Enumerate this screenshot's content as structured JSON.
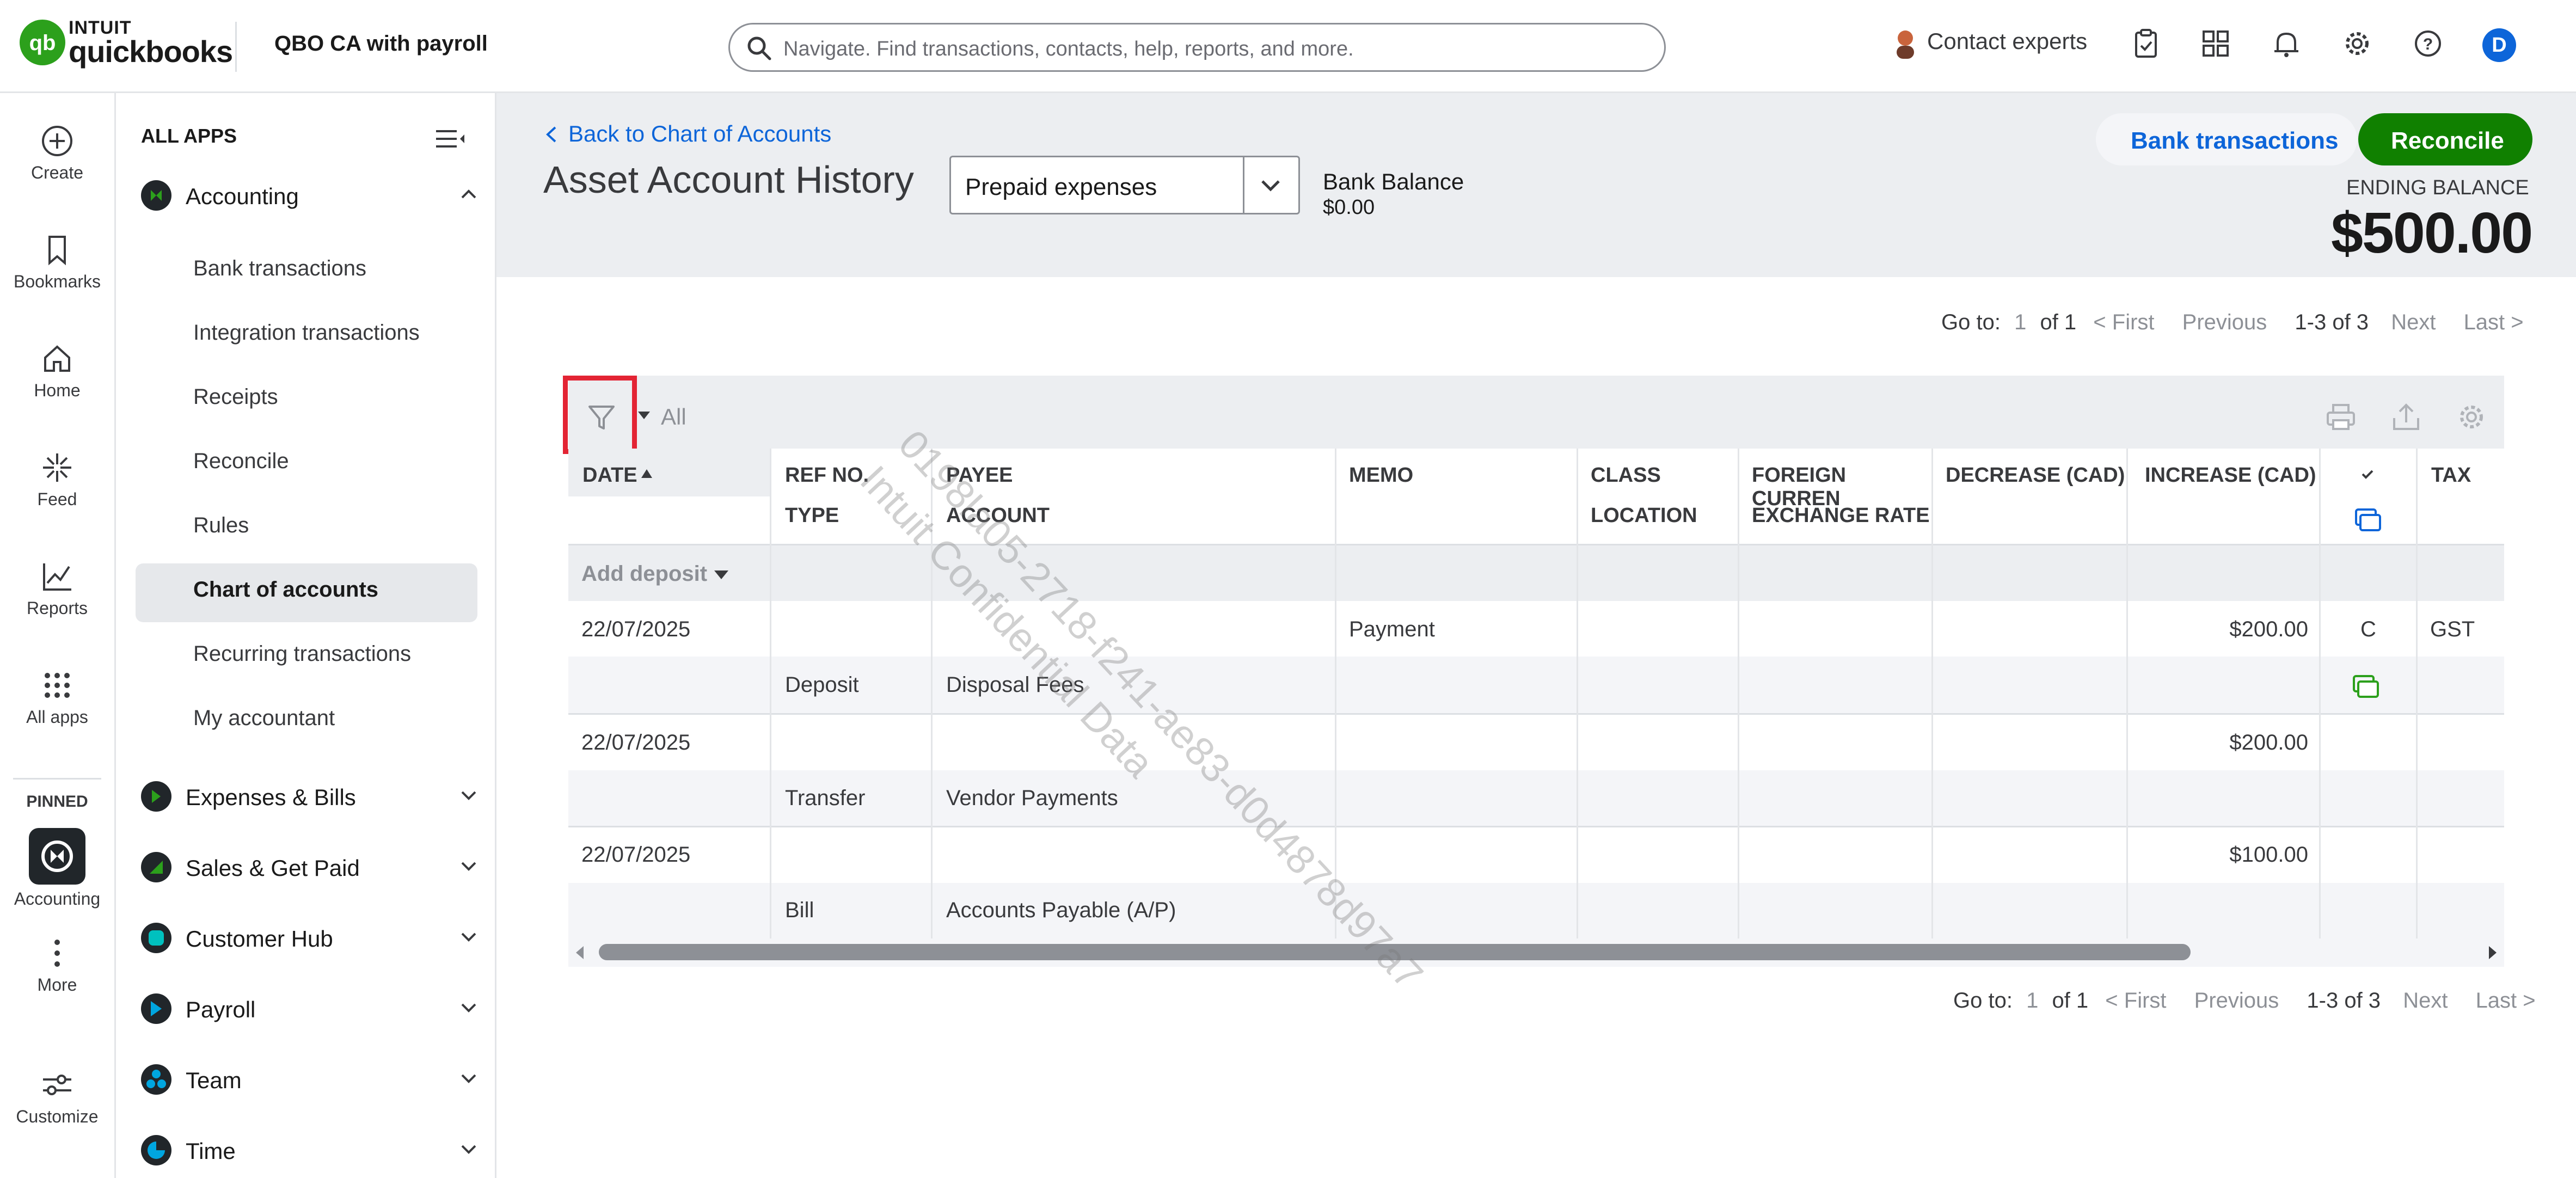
{
  "topbar": {
    "logo_top": "INTUIT",
    "logo_main": "quickbooks",
    "company": "QBO CA with payroll",
    "search_placeholder": "Navigate. Find transactions, contacts, help, reports, and more.",
    "contact_experts": "Contact experts",
    "avatar_letter": "D"
  },
  "rail": {
    "create": "Create",
    "bookmarks": "Bookmarks",
    "home": "Home",
    "feed": "Feed",
    "reports": "Reports",
    "all_apps": "All apps",
    "pinned": "PINNED",
    "accounting": "Accounting",
    "more": "More",
    "customize": "Customize"
  },
  "nav": {
    "all_apps": "ALL APPS",
    "accounting": "Accounting",
    "sub": [
      "Bank transactions",
      "Integration transactions",
      "Receipts",
      "Reconcile",
      "Rules",
      "Chart of accounts",
      "Recurring transactions",
      "My accountant"
    ],
    "sections": [
      "Expenses & Bills",
      "Sales & Get Paid",
      "Customer Hub",
      "Payroll",
      "Team",
      "Time"
    ]
  },
  "header": {
    "back": "Back to Chart of Accounts",
    "title": "Asset Account History",
    "account": "Prepaid expenses",
    "bank_balance_label": "Bank Balance",
    "bank_balance": "$0.00",
    "bank_transactions_btn": "Bank transactions",
    "reconcile_btn": "Reconcile",
    "ending_balance_label": "ENDING BALANCE",
    "ending_balance": "$500.00"
  },
  "pager": {
    "goto": "Go to:",
    "page": "1",
    "of": "of 1",
    "first": "< First",
    "previous": "Previous",
    "range": "1-3 of 3",
    "next": "Next",
    "last": "Last >"
  },
  "toolbar": {
    "filter_value": "All"
  },
  "columns": {
    "date": "DATE",
    "ref": "REF NO.",
    "type": "TYPE",
    "payee": "PAYEE",
    "account": "ACCOUNT",
    "memo": "MEMO",
    "class": "CLASS",
    "location": "LOCATION",
    "foreign": "FOREIGN CURREN",
    "exchange": "EXCHANGE RATE",
    "decrease": "DECREASE (CAD)",
    "increase": "INCREASE (CAD)",
    "tax": "TAX"
  },
  "add_deposit": "Add deposit",
  "rows": [
    {
      "date": "22/07/2025",
      "type": "Deposit",
      "account": "Disposal Fees",
      "memo": "Payment",
      "increase": "$200.00",
      "status": "C",
      "tax": "GST"
    },
    {
      "date": "22/07/2025",
      "type": "Transfer",
      "account": "Vendor Payments",
      "memo": "",
      "increase": "$200.00",
      "status": "",
      "tax": ""
    },
    {
      "date": "22/07/2025",
      "type": "Bill",
      "account": "Accounts Payable (A/P)",
      "memo": "",
      "increase": "$100.00",
      "status": "",
      "tax": ""
    }
  ],
  "watermark": [
    "0198la05-2718-f241-ae83-d0d4878d97a7",
    "Intuit Confidential Data"
  ],
  "colors": {
    "brand_green": "#2ca01c",
    "reconcile_green": "#108000",
    "link_blue": "#0d65d9",
    "highlight_red": "#e32434"
  }
}
